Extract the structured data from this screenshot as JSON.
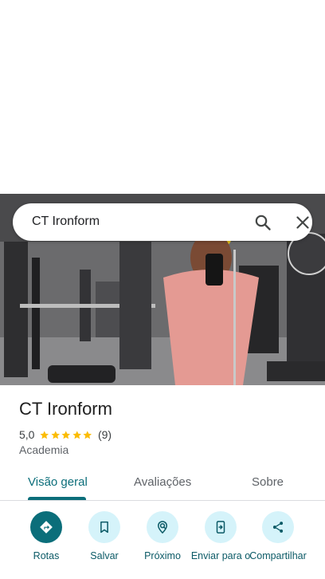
{
  "search": {
    "query": "CT Ironform"
  },
  "place": {
    "name": "CT Ironform",
    "rating": "5,0",
    "stars": 5,
    "review_count": "(9)",
    "category": "Academia"
  },
  "tabs": [
    {
      "label": "Visão geral",
      "active": true
    },
    {
      "label": "Avaliações",
      "active": false
    },
    {
      "label": "Sobre",
      "active": false
    }
  ],
  "actions": [
    {
      "label": "Rotas",
      "icon": "directions-icon"
    },
    {
      "label": "Salvar",
      "icon": "bookmark-icon"
    },
    {
      "label": "Próximo",
      "icon": "nearby-icon"
    },
    {
      "label": "Enviar para o",
      "icon": "send-to-phone-icon"
    },
    {
      "label": "Compartilhar",
      "icon": "share-icon"
    }
  ],
  "colors": {
    "accent": "#0b6e7a",
    "action_bg": "#d5f3fa",
    "star": "#fbbc04"
  }
}
